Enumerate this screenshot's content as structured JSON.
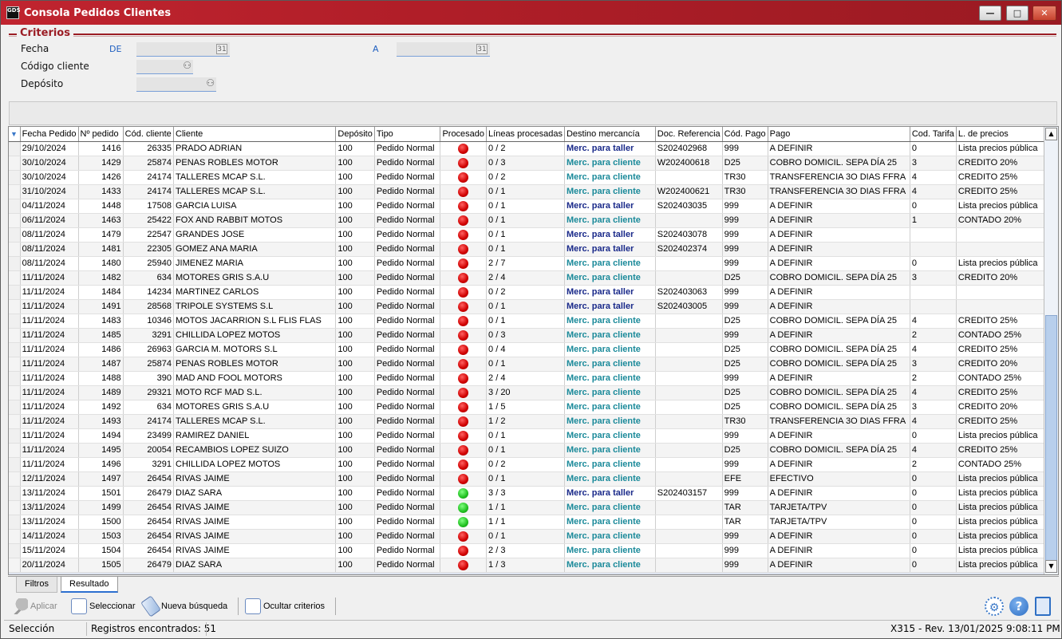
{
  "window": {
    "title": "Consola Pedidos Clientes",
    "app_badge": "GDS",
    "min": "—",
    "max": "□",
    "close": "✕"
  },
  "criteria": {
    "title": "Criterios",
    "fecha_label": "Fecha",
    "de_label": "DE",
    "a_label": "A",
    "cliente_label": "Código cliente",
    "deposito_label": "Depósito",
    "calendar_text": "31"
  },
  "grid": {
    "columns": [
      "Fecha Pedido",
      "Nº pedido",
      "Cód. cliente",
      "Cliente",
      "Depósito",
      "Tipo",
      "Procesado",
      "Líneas procesadas",
      "Destino mercancía",
      "Doc. Referencia",
      "Cód. Pago",
      "Pago",
      "Cod. Tarifa",
      "L. de precios"
    ],
    "rows": [
      [
        "29/10/2024",
        "1416",
        "26335",
        "PRADO ADRIAN",
        "100",
        "Pedido Normal",
        "red",
        "0 / 2",
        "Merc. para taller",
        "S202402968",
        "999",
        "A DEFINIR",
        "0",
        "Lista precios pública"
      ],
      [
        "30/10/2024",
        "1429",
        "25874",
        "PENAS ROBLES MOTOR",
        "100",
        "Pedido Normal",
        "red",
        "0 / 3",
        "Merc. para cliente",
        "W202400618",
        "D25",
        "COBRO DOMICIL. SEPA DÍA 25",
        "3",
        "CREDITO 20%"
      ],
      [
        "30/10/2024",
        "1426",
        "24174",
        "TALLERES MCAP S.L.",
        "100",
        "Pedido Normal",
        "red",
        "0 / 2",
        "Merc. para cliente",
        "",
        "TR30",
        "TRANSFERENCIA 3O DIAS FFRA",
        "4",
        "CREDITO 25%"
      ],
      [
        "31/10/2024",
        "1433",
        "24174",
        "TALLERES MCAP S.L.",
        "100",
        "Pedido Normal",
        "red",
        "0 / 1",
        "Merc. para cliente",
        "W202400621",
        "TR30",
        "TRANSFERENCIA 3O DIAS FFRA",
        "4",
        "CREDITO 25%"
      ],
      [
        "04/11/2024",
        "1448",
        "17508",
        "GARCIA LUISA",
        "100",
        "Pedido Normal",
        "red",
        "0 / 1",
        "Merc. para taller",
        "S202403035",
        "999",
        "A DEFINIR",
        "0",
        "Lista precios pública"
      ],
      [
        "06/11/2024",
        "1463",
        "25422",
        "FOX AND RABBIT MOTOS",
        "100",
        "Pedido Normal",
        "red",
        "0 / 1",
        "Merc. para cliente",
        "",
        "999",
        "A DEFINIR",
        "1",
        "CONTADO 20%"
      ],
      [
        "08/11/2024",
        "1479",
        "22547",
        "GRANDES JOSE",
        "100",
        "Pedido Normal",
        "red",
        "0 / 1",
        "Merc. para taller",
        "S202403078",
        "999",
        "A DEFINIR",
        "",
        ""
      ],
      [
        "08/11/2024",
        "1481",
        "22305",
        "GOMEZ ANA MARIA",
        "100",
        "Pedido Normal",
        "red",
        "0 / 1",
        "Merc. para taller",
        "S202402374",
        "999",
        "A DEFINIR",
        "",
        ""
      ],
      [
        "08/11/2024",
        "1480",
        "25940",
        "JIMENEZ MARIA",
        "100",
        "Pedido Normal",
        "red",
        "2 / 7",
        "Merc. para cliente",
        "",
        "999",
        "A DEFINIR",
        "0",
        "Lista precios pública"
      ],
      [
        "11/11/2024",
        "1482",
        "634",
        "MOTORES GRIS S.A.U",
        "100",
        "Pedido Normal",
        "red",
        "2 / 4",
        "Merc. para cliente",
        "",
        "D25",
        "COBRO DOMICIL. SEPA DÍA 25",
        "3",
        "CREDITO 20%"
      ],
      [
        "11/11/2024",
        "1484",
        "14234",
        "MARTINEZ CARLOS",
        "100",
        "Pedido Normal",
        "red",
        "0 / 2",
        "Merc. para taller",
        "S202403063",
        "999",
        "A DEFINIR",
        "",
        ""
      ],
      [
        "11/11/2024",
        "1491",
        "28568",
        "TRIPOLE SYSTEMS S.L",
        "100",
        "Pedido Normal",
        "red",
        "0 / 1",
        "Merc. para taller",
        "S202403005",
        "999",
        "A DEFINIR",
        "",
        ""
      ],
      [
        "11/11/2024",
        "1483",
        "10346",
        "MOTOS JACARRION S.L FLIS FLAS",
        "100",
        "Pedido Normal",
        "red",
        "0 / 1",
        "Merc. para cliente",
        "",
        "D25",
        "COBRO DOMICIL. SEPA DÍA 25",
        "4",
        "CREDITO 25%"
      ],
      [
        "11/11/2024",
        "1485",
        "3291",
        "CHILLIDA LOPEZ MOTOS",
        "100",
        "Pedido Normal",
        "red",
        "0 / 3",
        "Merc. para cliente",
        "",
        "999",
        "A DEFINIR",
        "2",
        "CONTADO 25%"
      ],
      [
        "11/11/2024",
        "1486",
        "26963",
        "GARCIA M. MOTORS S.L",
        "100",
        "Pedido Normal",
        "red",
        "0 / 4",
        "Merc. para cliente",
        "",
        "D25",
        "COBRO DOMICIL. SEPA DÍA 25",
        "4",
        "CREDITO 25%"
      ],
      [
        "11/11/2024",
        "1487",
        "25874",
        "PENAS ROBLES MOTOR",
        "100",
        "Pedido Normal",
        "red",
        "0 / 1",
        "Merc. para cliente",
        "",
        "D25",
        "COBRO DOMICIL. SEPA DÍA 25",
        "3",
        "CREDITO 20%"
      ],
      [
        "11/11/2024",
        "1488",
        "390",
        "MAD AND FOOL MOTORS",
        "100",
        "Pedido Normal",
        "red",
        "2 / 4",
        "Merc. para cliente",
        "",
        "999",
        "A DEFINIR",
        "2",
        "CONTADO 25%"
      ],
      [
        "11/11/2024",
        "1489",
        "29321",
        "MOTO RCF MAD S.L.",
        "100",
        "Pedido Normal",
        "red",
        "3 / 20",
        "Merc. para cliente",
        "",
        "D25",
        "COBRO DOMICIL. SEPA DÍA 25",
        "4",
        "CREDITO 25%"
      ],
      [
        "11/11/2024",
        "1492",
        "634",
        "MOTORES GRIS S.A.U",
        "100",
        "Pedido Normal",
        "red",
        "1 / 5",
        "Merc. para cliente",
        "",
        "D25",
        "COBRO DOMICIL. SEPA DÍA 25",
        "3",
        "CREDITO 20%"
      ],
      [
        "11/11/2024",
        "1493",
        "24174",
        "TALLERES MCAP S.L.",
        "100",
        "Pedido Normal",
        "red",
        "1 / 2",
        "Merc. para cliente",
        "",
        "TR30",
        "TRANSFERENCIA 3O DIAS FFRA",
        "4",
        "CREDITO 25%"
      ],
      [
        "11/11/2024",
        "1494",
        "23499",
        "RAMIREZ DANIEL",
        "100",
        "Pedido Normal",
        "red",
        "0 / 1",
        "Merc. para cliente",
        "",
        "999",
        "A DEFINIR",
        "0",
        "Lista precios pública"
      ],
      [
        "11/11/2024",
        "1495",
        "20054",
        "RECAMBIOS LOPEZ SUIZO",
        "100",
        "Pedido Normal",
        "red",
        "0 / 1",
        "Merc. para cliente",
        "",
        "D25",
        "COBRO DOMICIL. SEPA DÍA 25",
        "4",
        "CREDITO 25%"
      ],
      [
        "11/11/2024",
        "1496",
        "3291",
        "CHILLIDA LOPEZ MOTOS",
        "100",
        "Pedido Normal",
        "red",
        "0 / 2",
        "Merc. para cliente",
        "",
        "999",
        "A DEFINIR",
        "2",
        "CONTADO 25%"
      ],
      [
        "12/11/2024",
        "1497",
        "26454",
        "RIVAS JAIME",
        "100",
        "Pedido Normal",
        "red",
        "0 / 1",
        "Merc. para cliente",
        "",
        "EFE",
        "EFECTIVO",
        "0",
        "Lista precios pública"
      ],
      [
        "13/11/2024",
        "1501",
        "26479",
        "DIAZ SARA",
        "100",
        "Pedido Normal",
        "green",
        "3 / 3",
        "Merc. para taller",
        "S202403157",
        "999",
        "A DEFINIR",
        "0",
        "Lista precios pública"
      ],
      [
        "13/11/2024",
        "1499",
        "26454",
        "RIVAS JAIME",
        "100",
        "Pedido Normal",
        "green",
        "1 / 1",
        "Merc. para cliente",
        "",
        "TAR",
        "TARJETA/TPV",
        "0",
        "Lista precios pública"
      ],
      [
        "13/11/2024",
        "1500",
        "26454",
        "RIVAS JAIME",
        "100",
        "Pedido Normal",
        "green",
        "1 / 1",
        "Merc. para cliente",
        "",
        "TAR",
        "TARJETA/TPV",
        "0",
        "Lista precios pública"
      ],
      [
        "14/11/2024",
        "1503",
        "26454",
        "RIVAS JAIME",
        "100",
        "Pedido Normal",
        "red",
        "0 / 1",
        "Merc. para cliente",
        "",
        "999",
        "A DEFINIR",
        "0",
        "Lista precios pública"
      ],
      [
        "15/11/2024",
        "1504",
        "26454",
        "RIVAS JAIME",
        "100",
        "Pedido Normal",
        "red",
        "2 / 3",
        "Merc. para cliente",
        "",
        "999",
        "A DEFINIR",
        "0",
        "Lista precios pública"
      ],
      [
        "20/11/2024",
        "1505",
        "26479",
        "DIAZ SARA",
        "100",
        "Pedido Normal",
        "red",
        "1 / 3",
        "Merc. para cliente",
        "",
        "999",
        "A DEFINIR",
        "0",
        "Lista precios pública"
      ]
    ]
  },
  "colors": {
    "taller": "#1a2a8a",
    "cliente": "#1b8a9a",
    "red_dot": "#d00000",
    "green_dot": "#20c020",
    "title_bar": "#b01e28"
  },
  "tabs": [
    {
      "label": "Filtros"
    },
    {
      "label": "Resultado"
    }
  ],
  "toolbar": {
    "aplicar": "Aplicar",
    "seleccionar": "Seleccionar",
    "nueva": "Nueva búsqueda",
    "ocultar": "Ocultar criterios",
    "help": "?"
  },
  "status": {
    "mode": "Selección",
    "records": "Registros encontrados: 51",
    "version": "X315 - Rev. 13/01/2025 9:08:11 PM"
  }
}
